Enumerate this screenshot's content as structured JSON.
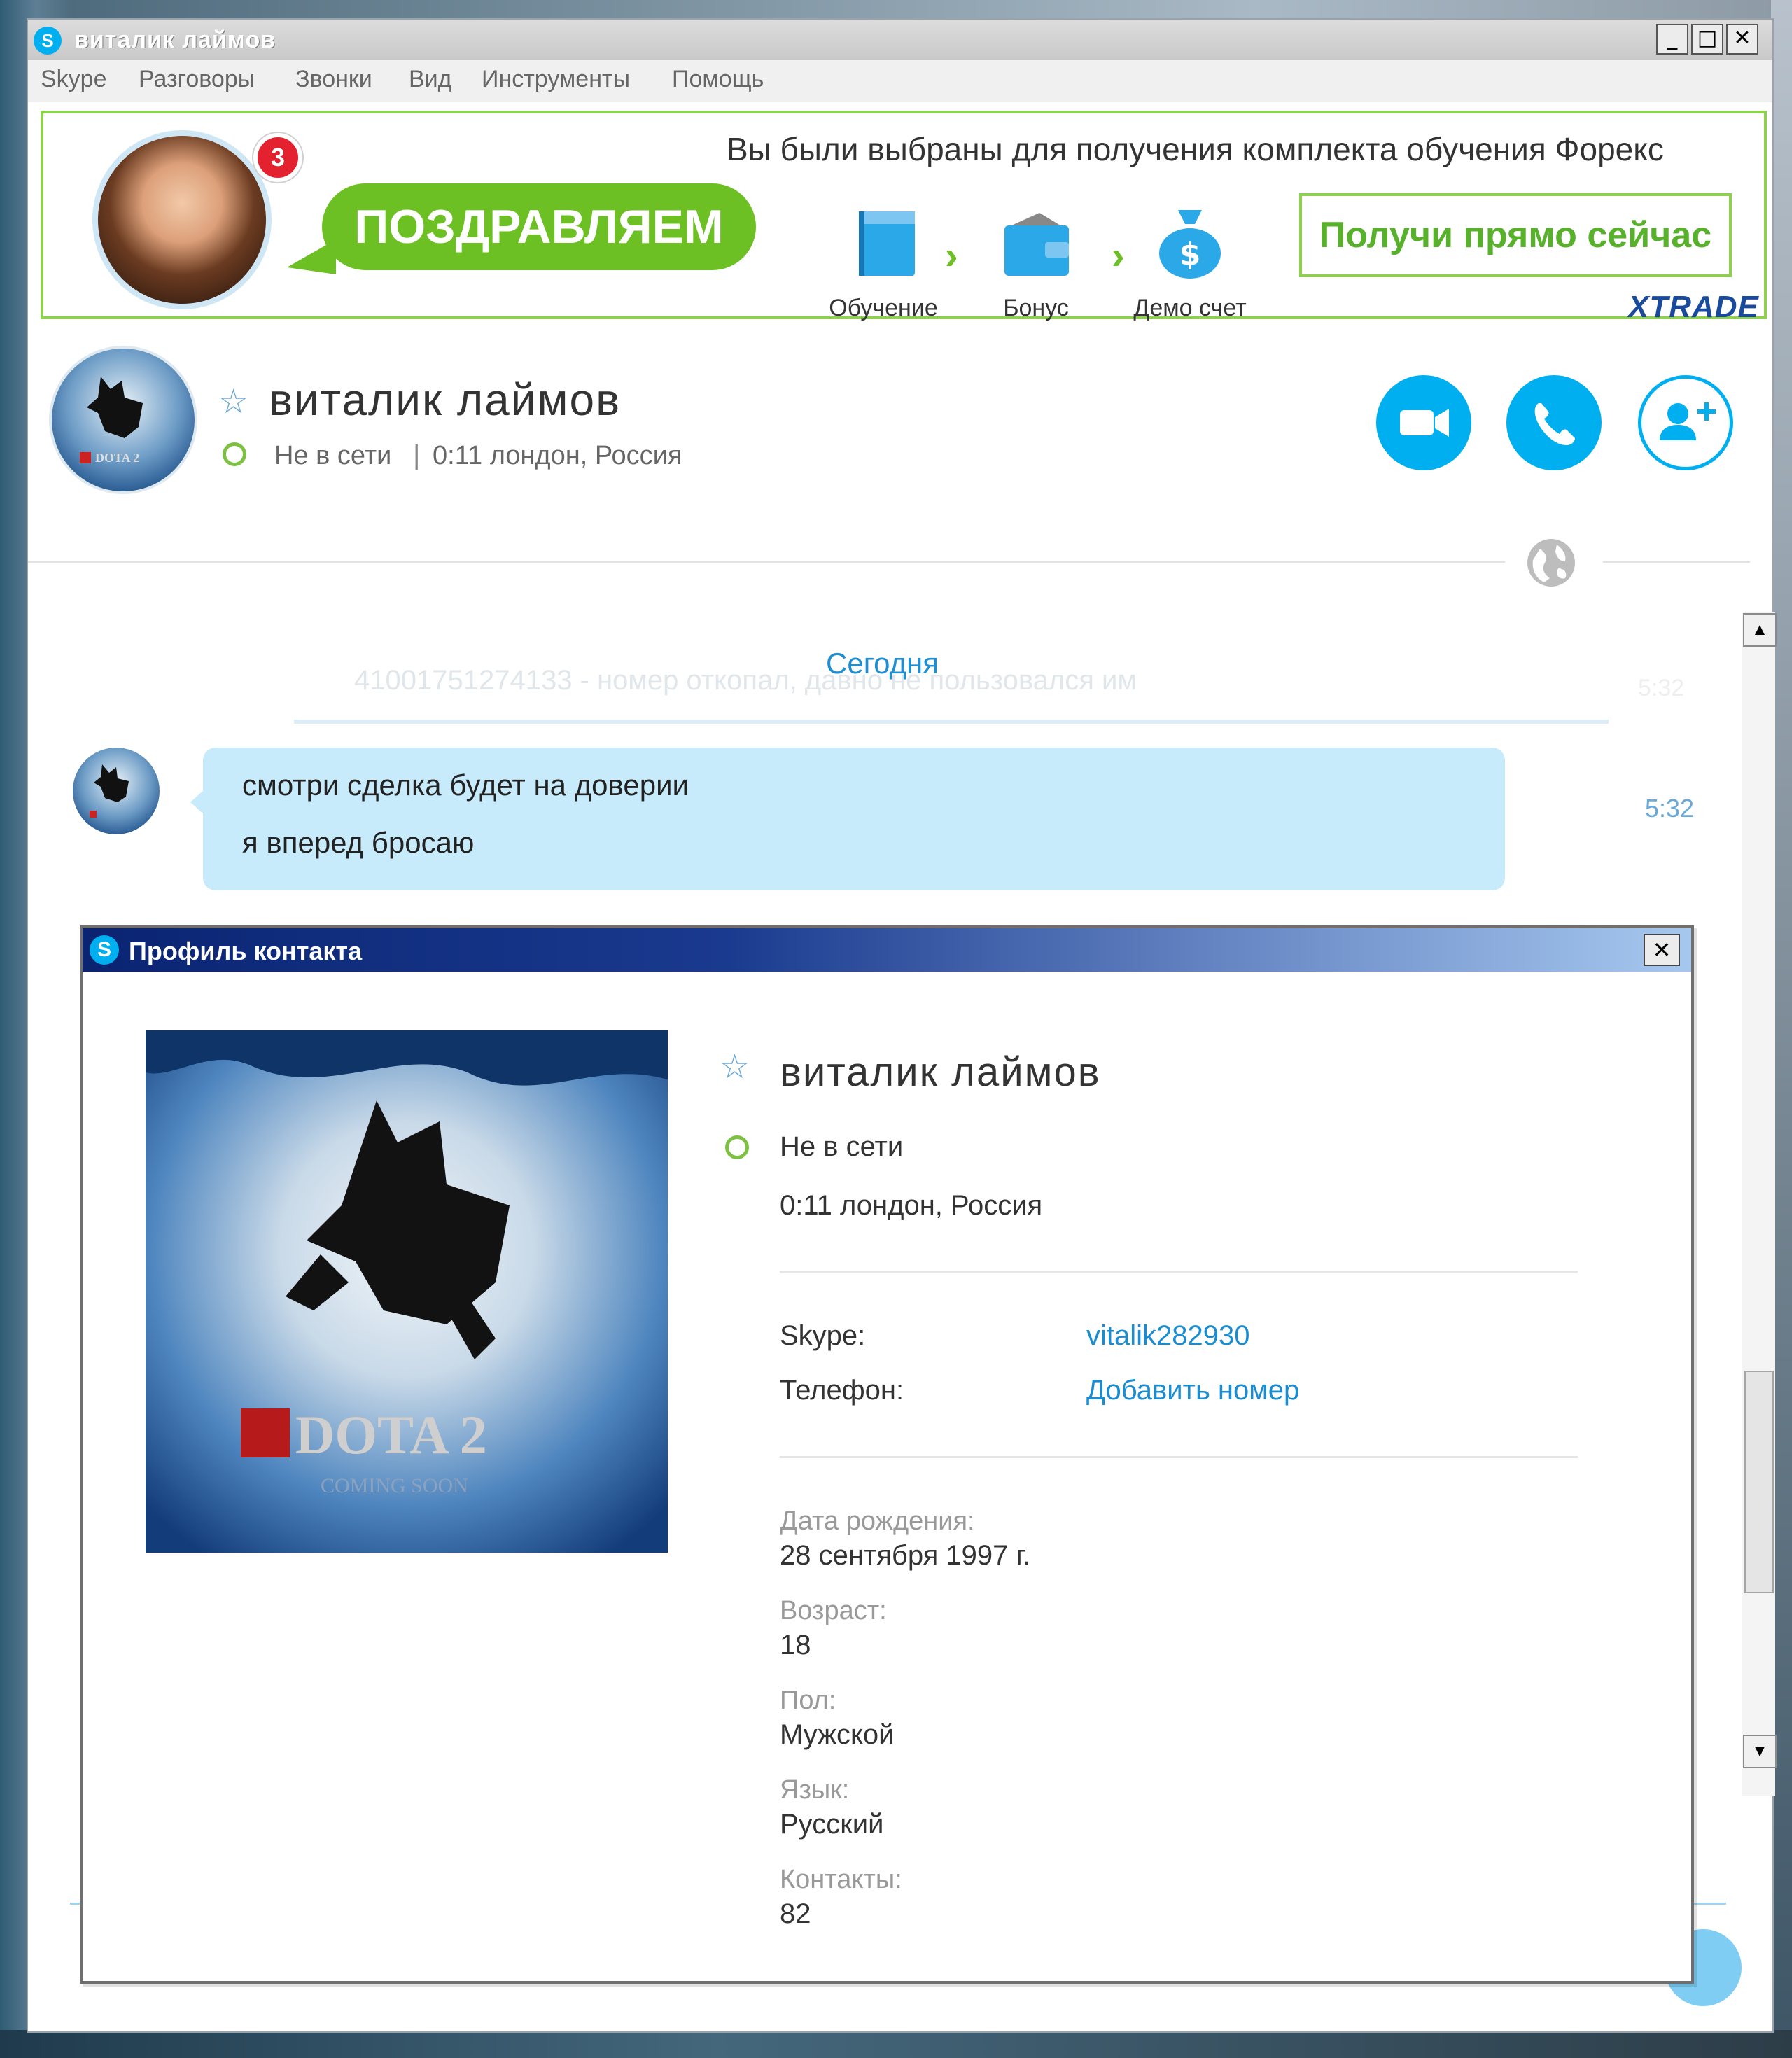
{
  "window": {
    "title": "виталик лаймов",
    "minimize": "_",
    "maximize": "□",
    "close": "✕"
  },
  "menu": [
    "Skype",
    "Разговоры",
    "Звонки",
    "Вид",
    "Инструменты",
    "Помощь"
  ],
  "ad": {
    "badge_count": "3",
    "bubble": "ПОЗДРАВЛЯЕМ",
    "headline": "Вы были выбраны для получения комплекта обучения Форекс",
    "steps": [
      "Обучение",
      "Бонус",
      "Демо счет"
    ],
    "arrow": "›",
    "cta": "Получи прямо сейчас",
    "brand": "XTRADE",
    "accent_color": "#6dc023"
  },
  "contact": {
    "star": "☆",
    "name": "виталик  лаймов",
    "status": "Не в сети",
    "separator": "|",
    "location": "0:11 лондон, Россия"
  },
  "chat": {
    "faded_message": "41001751274133 - номер откопал, давно не пользовался им",
    "faded_time": "5:32",
    "date_label": "Сегодня",
    "message_lines": [
      "смотри сделка будет на доверии",
      "я вперед бросаю"
    ],
    "message_time": "5:32",
    "scroll_up": "▲",
    "scroll_down": "▼"
  },
  "dialog": {
    "title": "Профиль контакта",
    "close": "✕",
    "name": "виталик  лаймов",
    "star": "☆",
    "status": "Не в сети",
    "location": "0:11 лондон, Россия",
    "skype_label": "Skype:",
    "skype_value": "vitalik282930",
    "phone_label": "Телефон:",
    "phone_value": "Добавить номер",
    "fields": [
      {
        "label": "Дата рождения:",
        "value": "28 сентября 1997 г."
      },
      {
        "label": "Возраст:",
        "value": "18"
      },
      {
        "label": "Пол:",
        "value": "Мужской"
      },
      {
        "label": "Язык:",
        "value": "Русский"
      },
      {
        "label": "Контакты:",
        "value": "82"
      }
    ],
    "avatar_text": "DOTA 2",
    "avatar_subtext": "COMING SOON"
  },
  "colors": {
    "skype_blue": "#00aff0",
    "bubble_blue": "#c7ebfb",
    "online_green": "#7cc142",
    "link_blue": "#1a8dd2"
  }
}
